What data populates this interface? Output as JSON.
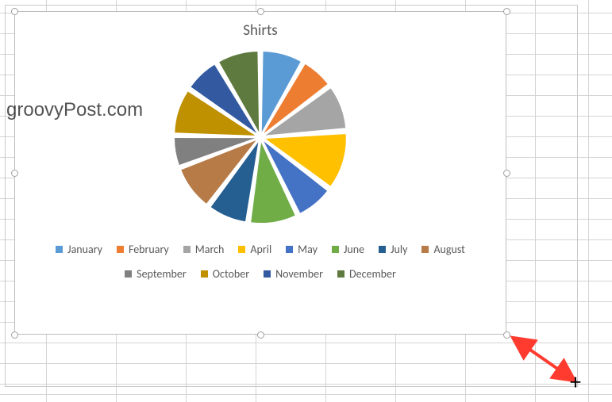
{
  "watermark": "groovyPost.com",
  "chart_data": {
    "type": "pie",
    "title": "Shirts",
    "series": [
      {
        "name": "January",
        "value": 8.3,
        "color": "#5B9BD5"
      },
      {
        "name": "February",
        "value": 6.5,
        "color": "#ED7D31"
      },
      {
        "name": "March",
        "value": 9.0,
        "color": "#A5A5A5"
      },
      {
        "name": "April",
        "value": 11.5,
        "color": "#FFC000"
      },
      {
        "name": "May",
        "value": 7.5,
        "color": "#4472C4"
      },
      {
        "name": "June",
        "value": 9.5,
        "color": "#70AD47"
      },
      {
        "name": "July",
        "value": 8.0,
        "color": "#255E91"
      },
      {
        "name": "August",
        "value": 9.0,
        "color": "#B77B48"
      },
      {
        "name": "September",
        "value": 6.0,
        "color": "#808080"
      },
      {
        "name": "October",
        "value": 9.2,
        "color": "#BF9000"
      },
      {
        "name": "November",
        "value": 7.0,
        "color": "#335AA1"
      },
      {
        "name": "December",
        "value": 8.5,
        "color": "#5E7A3F"
      }
    ],
    "legend_position": "bottom"
  }
}
